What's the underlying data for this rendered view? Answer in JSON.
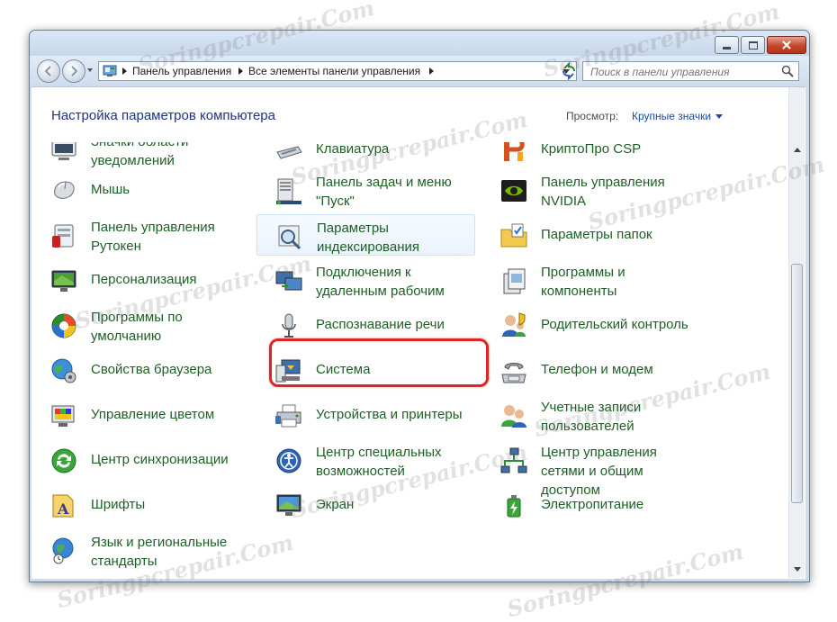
{
  "window": {
    "title_buttons": [
      "minimize-icon",
      "maximize-icon",
      "close-icon"
    ]
  },
  "address_bar": {
    "root_icon": "control-panel-icon",
    "breadcrumbs": [
      "Панель управления",
      "Все элементы панели управления"
    ]
  },
  "search": {
    "placeholder": "Поиск в панели управления"
  },
  "header": {
    "title": "Настройка параметров компьютера",
    "view_label": "Просмотр:",
    "view_value": "Крупные значки"
  },
  "items": {
    "col1": [
      {
        "label": "Значки области уведомлений",
        "icon": "notification-area-icon"
      },
      {
        "label": "Мышь",
        "icon": "mouse-icon"
      },
      {
        "label": "Панель управления Рутокен",
        "icon": "rutoken-icon"
      },
      {
        "label": "Персонализация",
        "icon": "personalization-icon"
      },
      {
        "label": "Программы по умолчанию",
        "icon": "default-programs-icon"
      },
      {
        "label": "Свойства браузера",
        "icon": "internet-options-icon"
      },
      {
        "label": "Управление цветом",
        "icon": "color-management-icon"
      },
      {
        "label": "Центр синхронизации",
        "icon": "sync-center-icon"
      },
      {
        "label": "Шрифты",
        "icon": "fonts-icon"
      },
      {
        "label": "Язык и региональные стандарты",
        "icon": "region-language-icon"
      }
    ],
    "col2": [
      {
        "label": "Клавиатура",
        "icon": "keyboard-icon"
      },
      {
        "label": "Панель задач и меню \"Пуск\"",
        "icon": "taskbar-icon"
      },
      {
        "label": "Параметры индексирования",
        "icon": "indexing-icon"
      },
      {
        "label": "Подключения к удаленным рабочим",
        "icon": "remote-desktop-icon"
      },
      {
        "label": "Распознавание речи",
        "icon": "microphone-icon"
      },
      {
        "label": "Система",
        "icon": "system-icon"
      },
      {
        "label": "Устройства и принтеры",
        "icon": "printer-icon"
      },
      {
        "label": "Центр специальных возможностей",
        "icon": "accessibility-icon"
      },
      {
        "label": "Экран",
        "icon": "display-icon"
      }
    ],
    "col3": [
      {
        "label": "КриптоПро CSP",
        "icon": "cryptopro-icon"
      },
      {
        "label": "Панель управления NVIDIA",
        "icon": "nvidia-icon"
      },
      {
        "label": "Параметры папок",
        "icon": "folder-options-icon"
      },
      {
        "label": "Программы и компоненты",
        "icon": "programs-features-icon"
      },
      {
        "label": "Родительский контроль",
        "icon": "parental-controls-icon"
      },
      {
        "label": "Телефон и модем",
        "icon": "phone-modem-icon"
      },
      {
        "label": "Учетные записи пользователей",
        "icon": "user-accounts-icon"
      },
      {
        "label": "Центр управления сетями и общим доступом",
        "icon": "network-center-icon"
      },
      {
        "label": "Электропитание",
        "icon": "power-options-icon"
      }
    ]
  },
  "highlighted_item": "Устройства и принтеры",
  "watermark": "Soringpcrepair.Com",
  "colors": {
    "link_green": "#1e5f26",
    "heading_blue": "#1e3287",
    "highlight_red": "#e02424"
  }
}
